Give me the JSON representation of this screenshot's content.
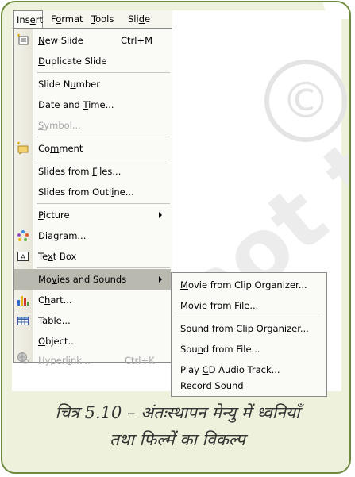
{
  "menubar": {
    "items": [
      {
        "pre": "Ins",
        "u": "e",
        "post": "rt"
      },
      {
        "pre": "F",
        "u": "o",
        "post": "rmat"
      },
      {
        "pre": "",
        "u": "T",
        "post": "ools"
      },
      {
        "pre": "Sli",
        "u": "d",
        "post": "e"
      }
    ]
  },
  "menu": {
    "items": [
      {
        "pre": "",
        "u": "N",
        "post": "ew Slide",
        "accel": "Ctrl+M",
        "icon": "new-slide-icon"
      },
      {
        "pre": "",
        "u": "D",
        "post": "uplicate Slide"
      },
      {
        "pre": "Slide N",
        "u": "u",
        "post": "mber"
      },
      {
        "pre": "Date and ",
        "u": "T",
        "post": "ime..."
      },
      {
        "pre": "",
        "u": "S",
        "post": "ymbol..."
      },
      {
        "pre": "Co",
        "u": "m",
        "post": "ment",
        "icon": "comment-icon"
      },
      {
        "pre": "Slides from ",
        "u": "F",
        "post": "iles..."
      },
      {
        "pre": "Slides from Outl",
        "u": "i",
        "post": "ne..."
      },
      {
        "pre": "",
        "u": "P",
        "post": "icture"
      },
      {
        "pre": "Dia",
        "u": "g",
        "post": "ram...",
        "icon": "diagram-icon"
      },
      {
        "pre": "Te",
        "u": "x",
        "post": "t Box",
        "icon": "text-box-icon"
      },
      {
        "pre": "Mo",
        "u": "v",
        "post": "ies and Sounds"
      },
      {
        "pre": "C",
        "u": "h",
        "post": "art...",
        "icon": "chart-icon"
      },
      {
        "pre": "Ta",
        "u": "b",
        "post": "le...",
        "icon": "table-icon"
      },
      {
        "pre": "",
        "u": "O",
        "post": "bject..."
      },
      {
        "pre": "Hyperl",
        "u": "i",
        "post": "nk...",
        "accel": "Ctrl+K",
        "icon": "hyperlink-icon"
      }
    ]
  },
  "submenu": {
    "items": [
      {
        "pre": "",
        "u": "M",
        "post": "ovie from Clip Organizer..."
      },
      {
        "pre": "Movie from ",
        "u": "F",
        "post": "ile..."
      },
      {
        "pre": "",
        "u": "S",
        "post": "ound from Clip Organizer..."
      },
      {
        "pre": "Sou",
        "u": "n",
        "post": "d from File..."
      },
      {
        "pre": "Play ",
        "u": "C",
        "post": "D Audio Track..."
      },
      {
        "pre": "",
        "u": "R",
        "post": "ecord Sound"
      }
    ]
  },
  "caption": {
    "line1": "चित्र 5.10 – अंतःस्थापन मेन्यु में ध्वनियाँ",
    "line2": "तथा फिल्में का विकल्प"
  },
  "watermark": {
    "symbol": "©",
    "text": "not to"
  },
  "colors": {
    "frame_border": "#6f8a3e",
    "frame_fill": "#eef2dc",
    "highlight": "#bab9b0"
  }
}
